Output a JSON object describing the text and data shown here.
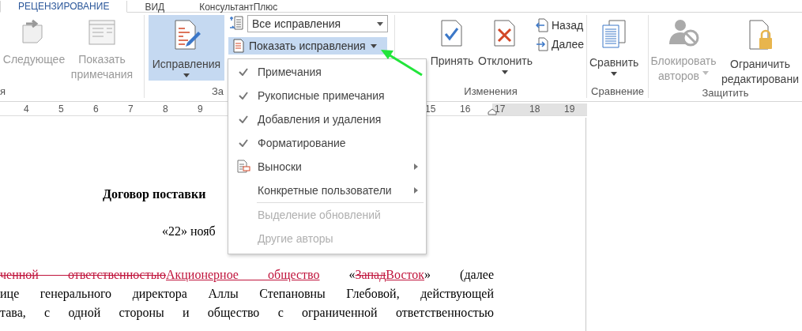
{
  "tabs": [
    {
      "label": "РЕЦЕНЗИРОВАНИЕ",
      "selected": true
    },
    {
      "label": "ВИД",
      "selected": false
    },
    {
      "label": "КонсультантПлюс",
      "selected": false
    }
  ],
  "review_group": {
    "label": "я",
    "next": {
      "label": "Следующее",
      "disabled": true
    },
    "show_comments": {
      "label": "Показать примечания",
      "disabled": true
    }
  },
  "tracking_group": {
    "label": "За",
    "track_changes": {
      "label": "Исправления",
      "highlighted": true
    },
    "markup_select": {
      "value": "Все исправления"
    },
    "show_markup": {
      "label": "Показать исправления",
      "highlighted": true
    }
  },
  "changes_group": {
    "label": "Изменения",
    "accept": {
      "label": "Принять"
    },
    "reject": {
      "label": "Отклонить"
    },
    "previous": {
      "label": "Назад"
    },
    "next": {
      "label": "Далее"
    }
  },
  "compare_group": {
    "label": "Сравнение",
    "compare": {
      "label": "Сравнить"
    }
  },
  "protect_group": {
    "label": "Защитить",
    "block_authors": {
      "label": "Блокировать авторов",
      "disabled": true
    },
    "restrict": {
      "label": "Ограничить редактировани",
      "disabled": false
    }
  },
  "ruler": {
    "left_numbers": [
      "4",
      "5",
      "6",
      "7",
      "8",
      "9"
    ],
    "right_numbers": [
      "15",
      "16",
      "17",
      "18",
      "19"
    ]
  },
  "show_markup_menu": {
    "items": [
      {
        "kind": "check",
        "label": "Примечания",
        "checked": true,
        "disabled": false
      },
      {
        "kind": "check",
        "label": "Рукописные примечания",
        "checked": true,
        "disabled": false
      },
      {
        "kind": "check",
        "label": "Добавления и удаления",
        "checked": true,
        "disabled": false
      },
      {
        "kind": "check",
        "label": "Форматирование",
        "checked": true,
        "disabled": false
      },
      {
        "kind": "submenu",
        "label": "Выноски",
        "has_icon": true
      },
      {
        "kind": "submenu",
        "label": "Конкретные пользователи",
        "has_icon": false
      },
      {
        "kind": "separator"
      },
      {
        "kind": "check",
        "label": "Выделение обновлений",
        "checked": false,
        "disabled": true
      },
      {
        "kind": "check",
        "label": "Другие авторы",
        "checked": false,
        "disabled": true
      }
    ]
  },
  "document": {
    "title": "Договор поставки",
    "date": "«22» нояб",
    "lines": [
      [
        {
          "kind": "deleted",
          "text": "ченной ответственностью"
        },
        {
          "kind": "inserted",
          "text": "Акционерное общество"
        },
        {
          "kind": "plain",
          "text": " «"
        },
        {
          "kind": "deleted",
          "text": "Запад"
        },
        {
          "kind": "inserted",
          "text": "Восток"
        },
        {
          "kind": "plain",
          "text": "» (далее"
        }
      ],
      [
        {
          "kind": "plain",
          "text": "ице генерального директора Аллы Степановны Глебовой, действующей"
        }
      ],
      [
        {
          "kind": "plain",
          "text": "тава, с одной стороны и общество с ограниченной ответственностью"
        }
      ]
    ]
  }
}
